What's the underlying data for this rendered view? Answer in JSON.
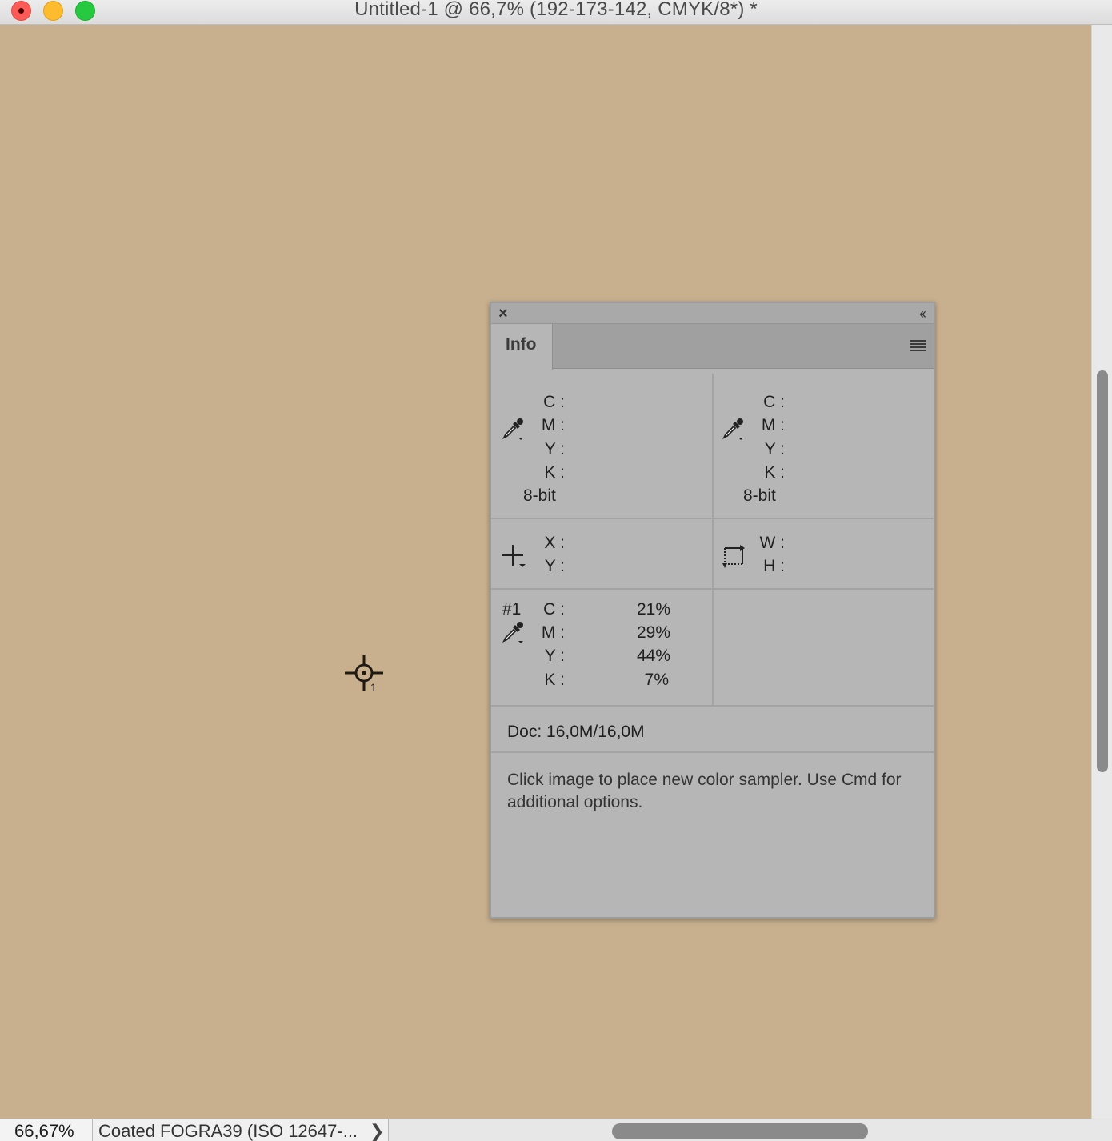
{
  "window": {
    "title": "Untitled-1 @ 66,7% (192-173-142, CMYK/8*) *",
    "canvas_color": "#c8b08e"
  },
  "status_bar": {
    "zoom": "66,67%",
    "profile": "Coated FOGRA39 (ISO 12647-...",
    "profile_arrow": "❯"
  },
  "sampler_marker": {
    "number": "1"
  },
  "info_panel": {
    "close_glyph": "×",
    "collapse_glyph": "‹‹",
    "tab_label": "Info",
    "readout_left": {
      "labels": [
        "C :",
        "M :",
        "Y :",
        "K :"
      ],
      "bit_depth": "8-bit"
    },
    "readout_right": {
      "labels": [
        "C :",
        "M :",
        "Y :",
        "K :"
      ],
      "bit_depth": "8-bit"
    },
    "position": {
      "x_label": "X :",
      "y_label": "Y :"
    },
    "size": {
      "w_label": "W :",
      "h_label": "H :"
    },
    "sampler": {
      "id": "#1",
      "labels": [
        "C :",
        "M :",
        "Y :",
        "K :"
      ],
      "values": [
        "21%",
        "29%",
        "44%",
        "7%"
      ]
    },
    "doc_size": "Doc: 16,0M/16,0M",
    "hint": "Click image to place new color sampler.  Use Cmd for additional options."
  }
}
